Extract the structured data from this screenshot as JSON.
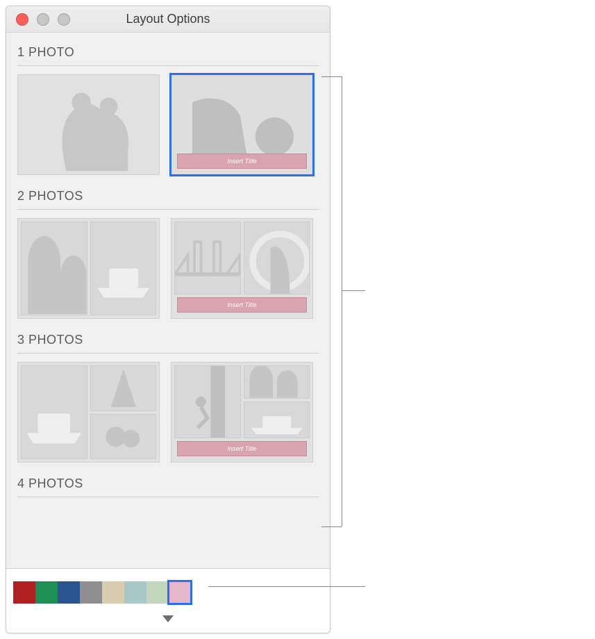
{
  "window": {
    "title": "Layout Options"
  },
  "sections": {
    "s1": "1 PHOTO",
    "s2": "2 PHOTOS",
    "s3": "3 PHOTOS",
    "s4": "4 PHOTOS"
  },
  "caption": "Insert Title",
  "selected_layout_index": 1,
  "swatches": [
    {
      "color": "#b22121"
    },
    {
      "color": "#1d8f52"
    },
    {
      "color": "#2a5490"
    },
    {
      "color": "#8f8f8f"
    },
    {
      "color": "#d8cdaf"
    },
    {
      "color": "#a8c7c7"
    },
    {
      "color": "#c3d7bf"
    },
    {
      "color": "#e3b7c7"
    }
  ],
  "selected_swatch_index": 7,
  "icons": {
    "close": "close-icon",
    "minimize": "minimize-icon",
    "maximize": "maximize-icon",
    "chevron": "chevron-down-icon"
  }
}
